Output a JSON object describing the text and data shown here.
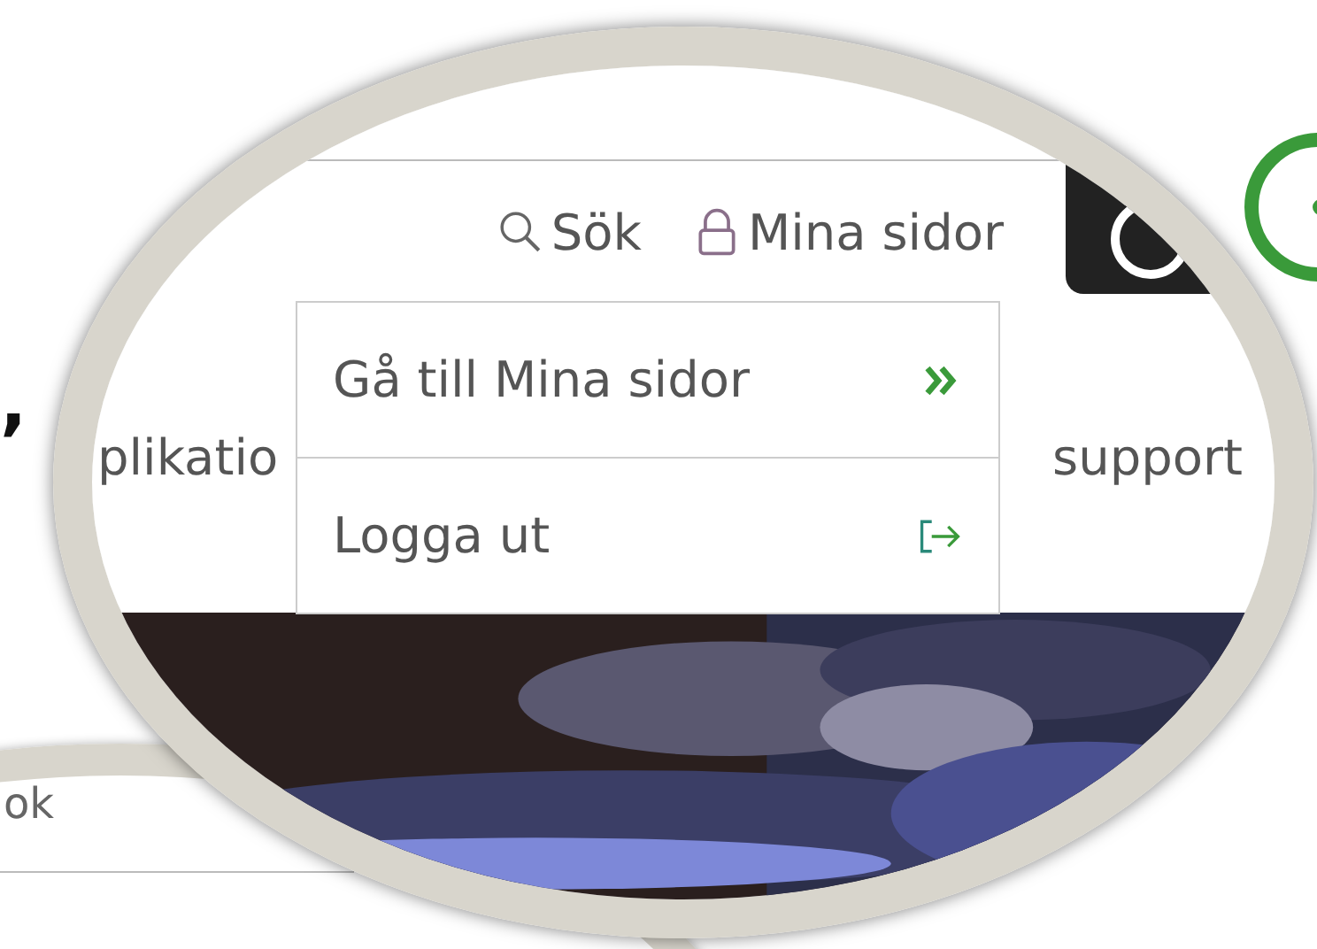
{
  "background_text": [
    ",",
    "ok"
  ],
  "header": {
    "search": {
      "label": "Sök"
    },
    "account": {
      "label": "Mina sidor",
      "expanded": true
    }
  },
  "dropdown": {
    "items": [
      {
        "label": "Gå till Mina sidor",
        "kind": "link"
      },
      {
        "label": "Logga ut",
        "kind": "logout"
      }
    ]
  },
  "nav": {
    "items": [
      "plikatio",
      "support"
    ]
  }
}
